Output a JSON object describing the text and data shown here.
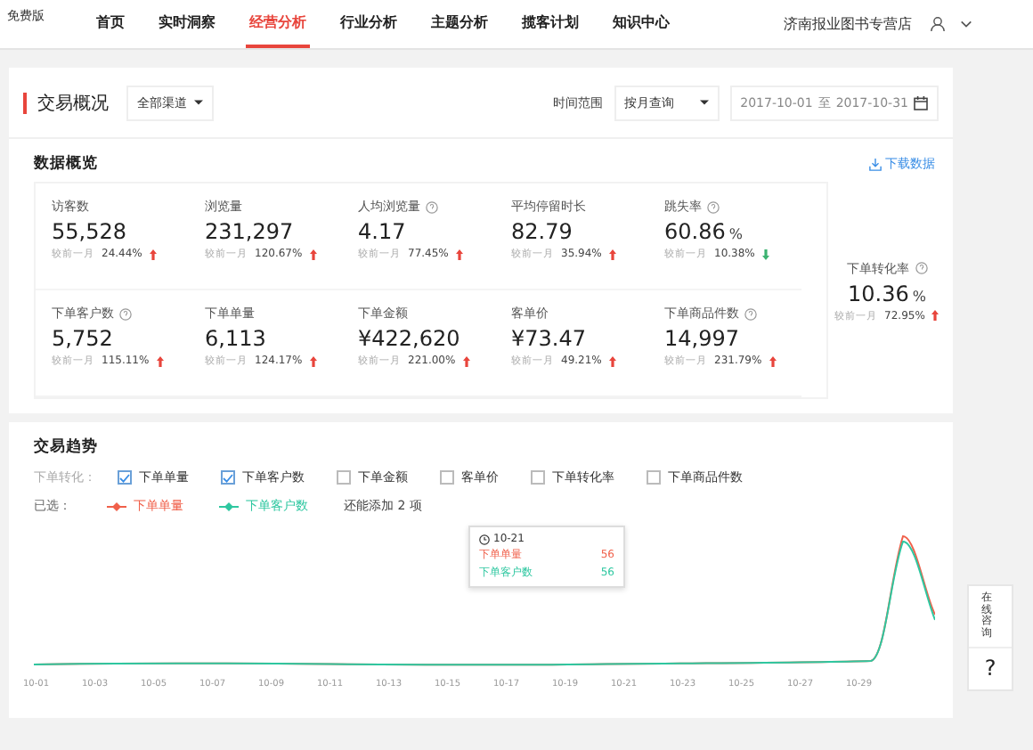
{
  "brand": {
    "badge": "免费版"
  },
  "nav": [
    {
      "label": "首页",
      "selected": false
    },
    {
      "label": "实时洞察",
      "selected": false
    },
    {
      "label": "经营分析",
      "selected": true
    },
    {
      "label": "行业分析",
      "selected": false
    },
    {
      "label": "主题分析",
      "selected": false
    },
    {
      "label": "揽客计划",
      "selected": false
    },
    {
      "label": "知识中心",
      "selected": false
    }
  ],
  "store": {
    "name": "济南报业图书专营店"
  },
  "header": {
    "title": "交易概况",
    "channel": "全部渠道",
    "time_label": "时间范围",
    "period": "按月查询",
    "date_from": "2017-10-01",
    "date_sep": "至",
    "date_to": "2017-10-31"
  },
  "overview": {
    "title": "数据概览",
    "download": "下载数据",
    "metrics": [
      {
        "label": "访客数",
        "help": false,
        "value": "55,528",
        "compare": "较前一月",
        "change": "24.44%",
        "increase": true
      },
      {
        "label": "浏览量",
        "help": false,
        "value": "231,297",
        "compare": "较前一月",
        "change": "120.67%",
        "increase": true
      },
      {
        "label": "人均浏览量",
        "help": true,
        "value": "4.17",
        "compare": "较前一月",
        "change": "77.45%",
        "increase": true
      },
      {
        "label": "平均停留时长",
        "help": false,
        "value": "82.79",
        "compare": "较前一月",
        "change": "35.94%",
        "increase": true
      },
      {
        "label": "跳失率",
        "help": true,
        "value": "60.86",
        "unit": "%",
        "compare": "较前一月",
        "change": "10.38%",
        "increase": false
      },
      {
        "label": "下单客户数",
        "help": true,
        "value": "5,752",
        "compare": "较前一月",
        "change": "115.11%",
        "increase": true
      },
      {
        "label": "下单单量",
        "help": false,
        "value": "6,113",
        "compare": "较前一月",
        "change": "124.17%",
        "increase": true
      },
      {
        "label": "下单金额",
        "help": false,
        "value": "¥422,620",
        "compare": "较前一月",
        "change": "221.00%",
        "increase": true
      },
      {
        "label": "客单价",
        "help": false,
        "value": "¥73.47",
        "compare": "较前一月",
        "change": "49.21%",
        "increase": true
      },
      {
        "label": "下单商品件数",
        "help": true,
        "value": "14,997",
        "compare": "较前一月",
        "change": "231.79%",
        "increase": true
      }
    ],
    "conversion": {
      "label": "下单转化率",
      "help": true,
      "value": "10.36",
      "unit": "%",
      "compare": "较前一月",
      "change": "72.95%",
      "increase": true
    }
  },
  "trend": {
    "title": "交易趋势",
    "filter_label": "下单转化：",
    "options": [
      {
        "label": "下单单量",
        "checked": true
      },
      {
        "label": "下单客户数",
        "checked": true
      },
      {
        "label": "下单金额",
        "checked": false
      },
      {
        "label": "客单价",
        "checked": false
      },
      {
        "label": "下单转化率",
        "checked": false
      },
      {
        "label": "下单商品件数",
        "checked": false
      }
    ],
    "selected_label": "已选：",
    "series": [
      {
        "name": "下单单量",
        "color": "#f0604a"
      },
      {
        "name": "下单客户数",
        "color": "#2ec7a0"
      }
    ],
    "remaining": "还能添加 2 项",
    "tooltip": {
      "date": "10-21",
      "rows": [
        {
          "name": "下单单量",
          "value": "56"
        },
        {
          "name": "下单客户数",
          "value": "56"
        }
      ]
    },
    "x_labels": [
      "10-01",
      "10-03",
      "10-05",
      "10-07",
      "10-09",
      "10-11",
      "10-13",
      "10-15",
      "10-17",
      "10-19",
      "10-21",
      "10-23",
      "10-25",
      "10-27",
      "10-29"
    ]
  },
  "side": {
    "consult": "在线咨询",
    "help": "?"
  }
}
